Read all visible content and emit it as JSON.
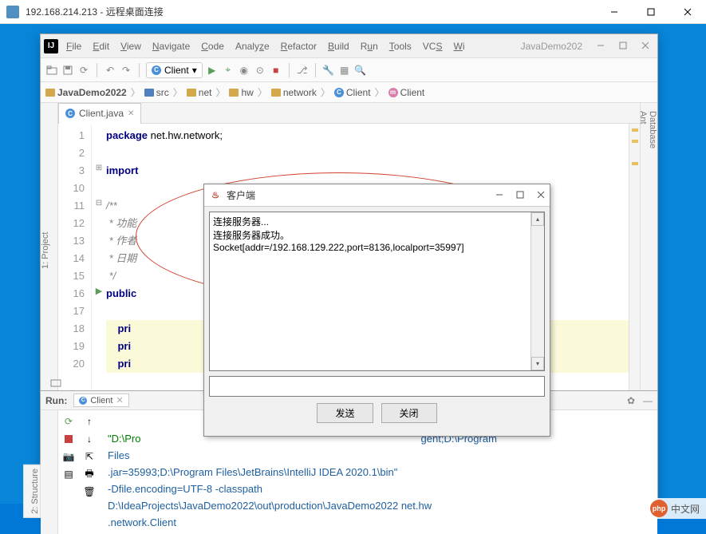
{
  "rdp": {
    "title": "192.168.214.213 - 远程桌面连接",
    "min": "—",
    "max": "☐",
    "close": "✕"
  },
  "ide": {
    "logo": "IJ",
    "menu": [
      "File",
      "Edit",
      "View",
      "Navigate",
      "Code",
      "Analyze",
      "Refactor",
      "Build",
      "Run",
      "Tools",
      "VCS",
      "Wi"
    ],
    "right_title": "JavaDemo202",
    "run_config": "Client",
    "breadcrumb": [
      "JavaDemo2022",
      "src",
      "net",
      "hw",
      "network",
      "Client",
      "Client"
    ],
    "left_tabs": {
      "project": "1: Project"
    },
    "right_tabs": [
      "Database",
      "Ant"
    ],
    "file_tab": {
      "name": "Client.java"
    },
    "lines": [
      "1",
      "2",
      "3",
      "10",
      "11",
      "12",
      "13",
      "14",
      "15",
      "16",
      "17",
      "18",
      "19",
      "20"
    ],
    "code": {
      "l1_kw": "package",
      "l1_rest": " net.hw.network;",
      "l3_kw": "import",
      "l11": "/**",
      "l12": " * 功能",
      "l13": " * 作者",
      "l14": " * 日期",
      "l15": " */",
      "l16_kw": "public ",
      "l18": "    pri",
      "l19": "    pri",
      "l20": "    pri"
    },
    "run": {
      "label": "Run:",
      "config_name": "Client",
      "console_l1": "\"D:\\Pro",
      "console_l2": "Files",
      "console_l3": ".jar=35993;D:\\Program Files\\JetBrains\\IntelliJ IDEA 2020.1\\bin\"",
      "console_l4": "-Dfile.encoding=UTF-8 -classpath",
      "console_l5": "D:\\IdeaProjects\\JavaDemo2022\\out\\production\\JavaDemo2022 net.hw",
      "console_l6": ".network.Client",
      "console_mid": "gent;D:\\Program"
    },
    "structure": "2: Structure"
  },
  "dialog": {
    "title": "客户端",
    "log_l1": "连接服务器...",
    "log_l2": "连接服务器成功。",
    "log_l3": "Socket[addr=/192.168.129.222,port=8136,localport=35997]",
    "btn_send": "发送",
    "btn_close": "关闭"
  },
  "watermark": "中文网"
}
